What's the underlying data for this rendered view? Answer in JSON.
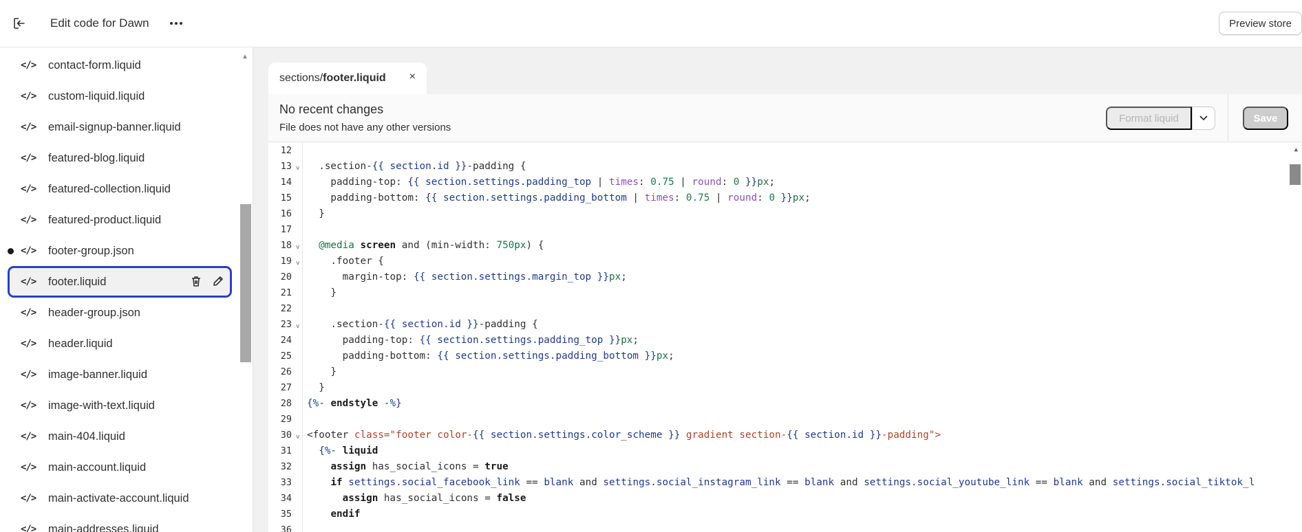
{
  "header": {
    "title": "Edit code for Dawn",
    "preview_label": "Preview store"
  },
  "sidebar": {
    "files": [
      {
        "name": "contact-form.liquid"
      },
      {
        "name": "custom-liquid.liquid"
      },
      {
        "name": "email-signup-banner.liquid"
      },
      {
        "name": "featured-blog.liquid"
      },
      {
        "name": "featured-collection.liquid"
      },
      {
        "name": "featured-product.liquid"
      },
      {
        "name": "footer-group.json"
      },
      {
        "name": "footer.liquid"
      },
      {
        "name": "header-group.json"
      },
      {
        "name": "header.liquid"
      },
      {
        "name": "image-banner.liquid"
      },
      {
        "name": "image-with-text.liquid"
      },
      {
        "name": "main-404.liquid"
      },
      {
        "name": "main-account.liquid"
      },
      {
        "name": "main-activate-account.liquid"
      },
      {
        "name": "main-addresses.liquid"
      }
    ],
    "icon_glyph": "</>"
  },
  "tab": {
    "path_prefix": "sections/",
    "file": "footer.liquid",
    "close_glyph": "×"
  },
  "toolbar": {
    "status_title": "No recent changes",
    "status_sub": "File does not have any other versions",
    "format_label": "Format liquid",
    "save_label": "Save"
  },
  "code": {
    "line_numbers": [
      "12",
      "13",
      "14",
      "15",
      "16",
      "17",
      "18",
      "19",
      "20",
      "21",
      "22",
      "23",
      "24",
      "25",
      "26",
      "27",
      "28",
      "29",
      "30",
      "31",
      "32",
      "33",
      "34",
      "35",
      "36"
    ]
  },
  "colors": {
    "selection_outline": "#2b3fbf",
    "liquid_variable": "#1f3a8a",
    "string": "#a8452a",
    "filter": "#8b4fbf"
  }
}
